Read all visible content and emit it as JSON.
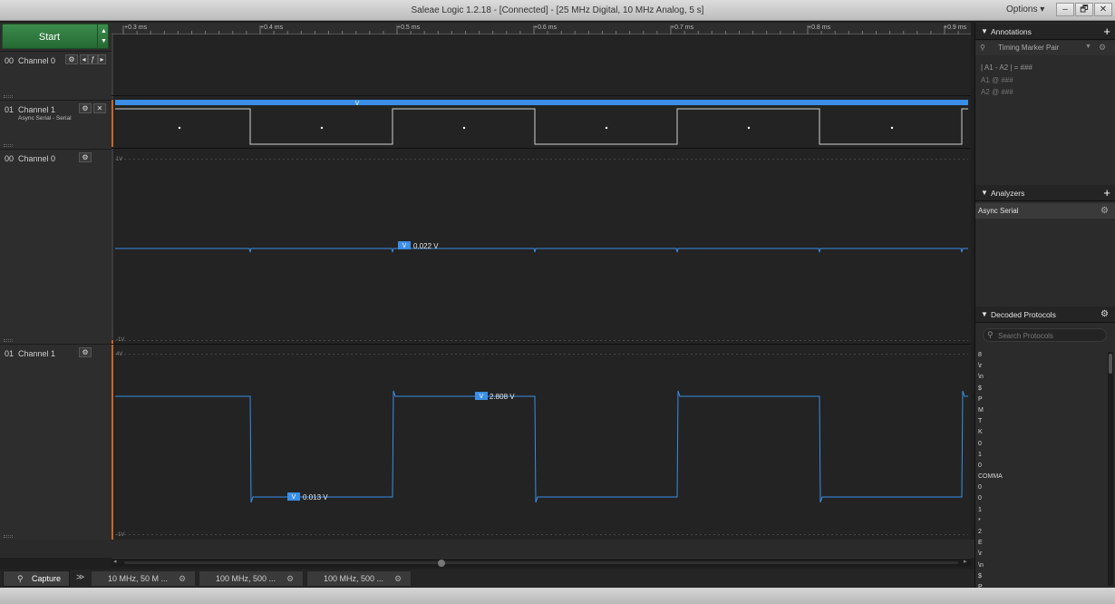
{
  "window": {
    "title": "Saleae Logic 1.2.18 - [Connected] - [25 MHz Digital, 10 MHz Analog, 5 s]",
    "options_label": "Options",
    "minimize": "–",
    "restore": "🗗",
    "close": "✕"
  },
  "start_button": {
    "label": "Start",
    "up_glyph": "▲",
    "down_glyph": "▼"
  },
  "channels": [
    {
      "num": "00",
      "name": "Channel 0",
      "sub": ""
    },
    {
      "num": "01",
      "name": "Channel 1",
      "sub": "Async Serial - Serial"
    },
    {
      "num": "00",
      "name": "Channel 0",
      "sub": ""
    },
    {
      "num": "01",
      "name": "Channel 1",
      "sub": ""
    }
  ],
  "time_ticks": [
    "+0.3 ms",
    "+0.4 ms",
    "+0.5 ms",
    "+0.6 ms",
    "+0.7 ms",
    "+0.8 ms",
    "+0.9 ms"
  ],
  "analyzer_marker": "V",
  "analog": {
    "ch0": {
      "top_label": "1V",
      "bottom_label": "-1V",
      "measure_badge": "V",
      "measure_value": "0.022 V"
    },
    "ch1": {
      "top_label": "4V",
      "bottom_label": "-1V",
      "high_badge": "V",
      "high_value": "2.808 V",
      "low_badge": "V",
      "low_value": "0.013 V"
    }
  },
  "capture_tab": {
    "label": "Capture",
    "expand": "≫"
  },
  "session_tabs": [
    "10 MHz, 50 M ...",
    "100 MHz, 500 ...",
    "100 MHz, 500 ..."
  ],
  "annotations": {
    "title": "Annotations",
    "marker_pair": "Timing Marker Pair",
    "formula": "| A1 - A2 | = ###",
    "a1": "A1 @ ###",
    "a2": "A2 @ ###"
  },
  "analyzers": {
    "title": "Analyzers",
    "items": [
      "Async Serial"
    ]
  },
  "decoded": {
    "title": "Decoded Protocols",
    "search_placeholder": "Search Protocols",
    "items": [
      "8",
      "\\r",
      "\\n",
      "$",
      "P",
      "M",
      "T",
      "K",
      "0",
      "1",
      "0",
      "COMMA",
      "0",
      "0",
      "1",
      "*",
      "2",
      "E",
      "\\r",
      "\\n",
      "$",
      "P"
    ]
  },
  "colors": {
    "accent": "#3a8ee6",
    "start_green": "#2f7d3f",
    "trigger_orange": "#c8662a"
  }
}
